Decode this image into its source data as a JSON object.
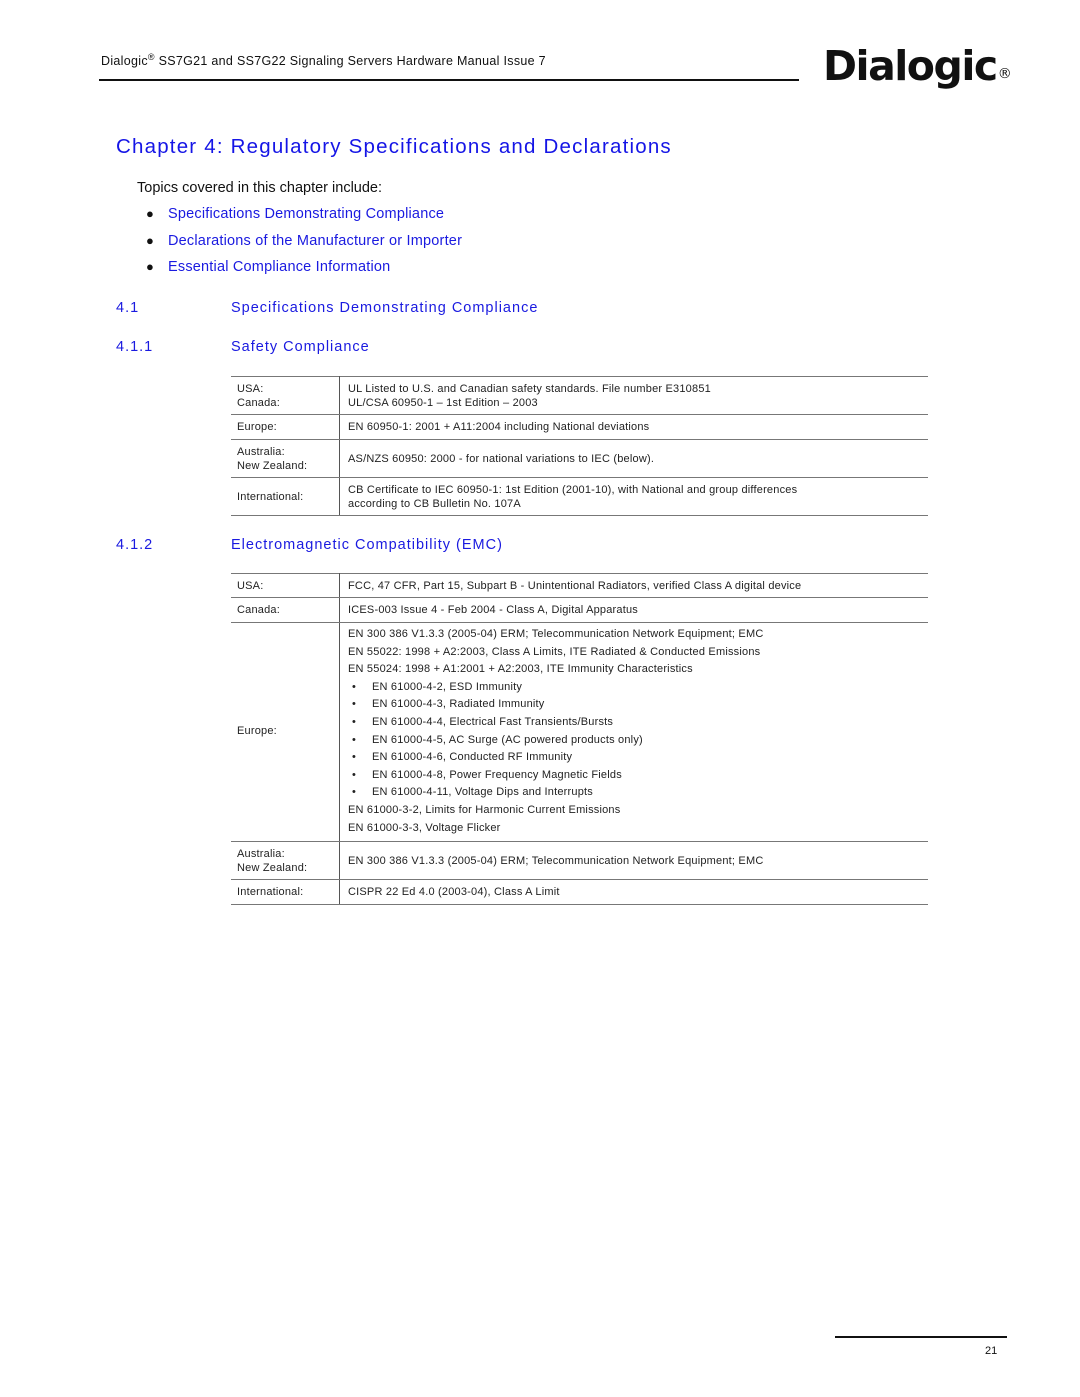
{
  "header": {
    "brand": "Dialogic",
    "reg_mark": "®",
    "title": " SS7G21 and SS7G22 Signaling Servers Hardware Manual  Issue 7",
    "logo_text": "Dialogic",
    "logo_reg": "®"
  },
  "chapter": {
    "title": "Chapter 4:  Regulatory Specifications and Declarations",
    "intro": "Topics covered in this chapter include:",
    "topics": [
      "Specifications Demonstrating Compliance",
      "Declarations of the Manufacturer or Importer",
      "Essential Compliance Information"
    ]
  },
  "sections": {
    "s41": {
      "num": "4.1",
      "title": "Specifications Demonstrating Compliance"
    },
    "s411": {
      "num": "4.1.1",
      "title": "Safety Compliance"
    },
    "s412": {
      "num": "4.1.2",
      "title": "Electromagnetic Compatibility (EMC)"
    }
  },
  "safety_table": [
    {
      "regions": [
        "USA:",
        "Canada:"
      ],
      "lines": [
        "UL Listed to U.S. and Canadian safety standards. File number E310851",
        "UL/CSA 60950-1 – 1st Edition – 2003"
      ]
    },
    {
      "regions": [
        "Europe:"
      ],
      "lines": [
        "EN 60950-1: 2001 + A11:2004 including National deviations"
      ]
    },
    {
      "regions": [
        "Australia:",
        "New Zealand:"
      ],
      "lines": [
        "AS/NZS 60950: 2000 - for national variations to IEC (below)."
      ]
    },
    {
      "regions": [
        "International:"
      ],
      "lines": [
        "CB Certificate to IEC 60950-1: 1st Edition (2001-10), with National and group differences",
        "according to CB Bulletin No. 107A"
      ]
    }
  ],
  "emc_table": {
    "usa": {
      "region": "USA:",
      "value": "FCC, 47 CFR, Part 15, Subpart B - Unintentional Radiators, verified Class A digital device"
    },
    "canada": {
      "region": "Canada:",
      "value": "ICES-003 Issue 4 - Feb 2004 - Class A, Digital Apparatus"
    },
    "europe": {
      "region": "Europe:",
      "lines_top": [
        "EN 300 386 V1.3.3 (2005-04) ERM; Telecommunication Network Equipment; EMC",
        "EN 55022: 1998 + A2:2003, Class A Limits, ITE Radiated & Conducted Emissions",
        "EN 55024: 1998 + A1:2001 + A2:2003, ITE Immunity Characteristics"
      ],
      "bullet": "•",
      "sub_items": [
        "EN 61000-4-2, ESD Immunity",
        "EN 61000-4-3, Radiated Immunity",
        "EN 61000-4-4, Electrical Fast Transients/Bursts",
        "EN 61000-4-5, AC Surge (AC powered products only)",
        "EN 61000-4-6, Conducted RF Immunity",
        "EN 61000-4-8, Power Frequency Magnetic Fields",
        "EN 61000-4-11, Voltage Dips and Interrupts"
      ],
      "lines_bottom": [
        "EN 61000-3-2, Limits for Harmonic Current Emissions",
        "EN 61000-3-3, Voltage Flicker"
      ]
    },
    "aus": {
      "regions": [
        "Australia:",
        "New Zealand:"
      ],
      "value": "EN 300 386 V1.3.3 (2005-04) ERM; Telecommunication Network Equipment; EMC"
    },
    "intl": {
      "region": "International:",
      "value": "CISPR 22 Ed 4.0 (2003-04), Class A Limit"
    }
  },
  "footer": {
    "page_number": "21"
  }
}
